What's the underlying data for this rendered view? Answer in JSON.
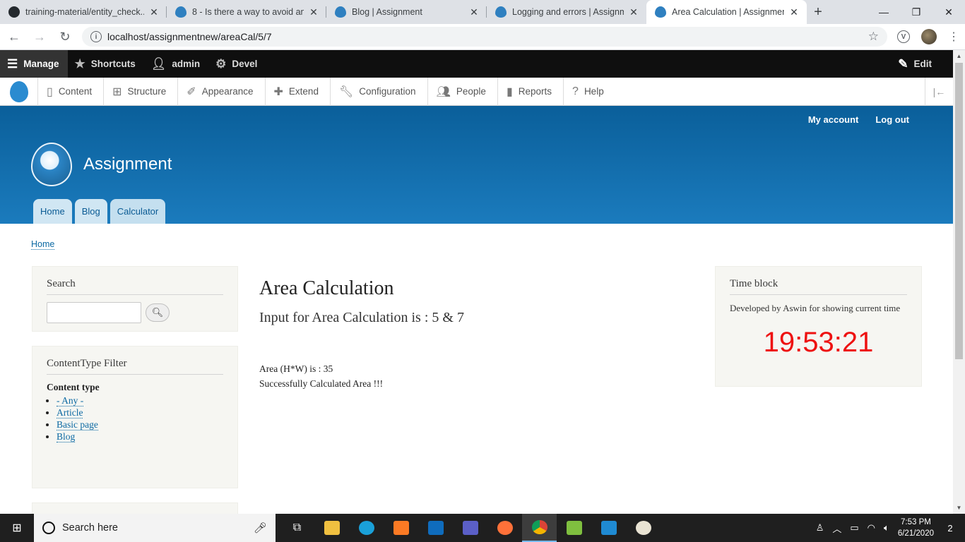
{
  "browser": {
    "tabs": [
      {
        "title": "training-material/entity_check...",
        "favicon": "github-icon"
      },
      {
        "title": "8 - Is there a way to avoid and...",
        "favicon": "drupal-answers-icon"
      },
      {
        "title": "Blog | Assignment",
        "favicon": "drupal-icon"
      },
      {
        "title": "Logging and errors | Assignme...",
        "favicon": "drupal-icon"
      },
      {
        "title": "Area Calculation | Assignment",
        "favicon": "drupal-icon",
        "active": true
      }
    ],
    "url": "localhost/assignmentnew/areaCal/5/7"
  },
  "toolbar": {
    "manage": "Manage",
    "shortcuts": "Shortcuts",
    "user": "admin",
    "devel": "Devel",
    "edit": "Edit"
  },
  "tray": {
    "content": "Content",
    "structure": "Structure",
    "appearance": "Appearance",
    "extend": "Extend",
    "configuration": "Configuration",
    "people": "People",
    "reports": "Reports",
    "help": "Help"
  },
  "header": {
    "my_account": "My account",
    "log_out": "Log out",
    "site_name": "Assignment",
    "tabs": [
      "Home",
      "Blog",
      "Calculator"
    ]
  },
  "breadcrumb": "Home",
  "search_block": {
    "title": "Search"
  },
  "filter_block": {
    "title": "ContentType Filter",
    "label": "Content type",
    "items": [
      "- Any -",
      "Article",
      "Basic page",
      "Blog"
    ]
  },
  "main": {
    "title": "Area Calculation",
    "input_line": "Input for Area Calculation is : 5 & 7",
    "result": "Area (H*W) is : 35",
    "status": "Successfully Calculated Area !!!"
  },
  "time_block": {
    "title": "Time block",
    "description": "Developed by Aswin for showing current time",
    "clock": "19:53:21",
    "clock_color": "#ee1111"
  },
  "taskbar": {
    "search_placeholder": "Search here",
    "time": "7:53 PM",
    "date": "6/21/2020",
    "notifications": "2"
  }
}
